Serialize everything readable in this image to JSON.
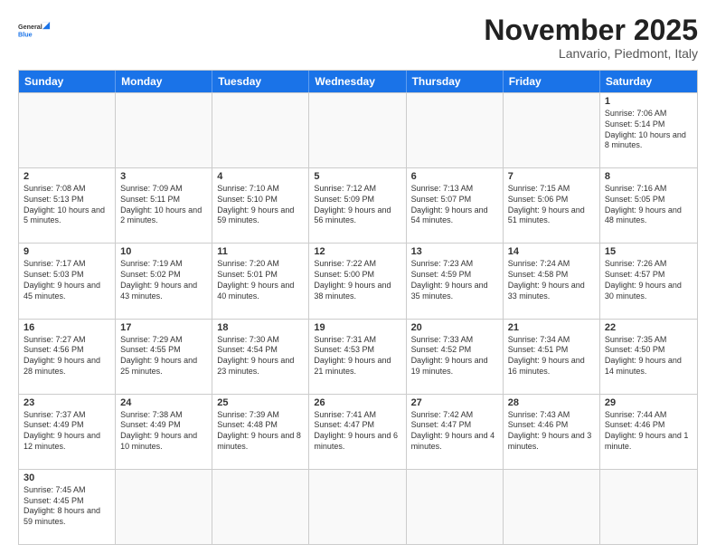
{
  "header": {
    "logo_general": "General",
    "logo_blue": "Blue",
    "month_title": "November 2025",
    "subtitle": "Lanvario, Piedmont, Italy"
  },
  "weekdays": [
    "Sunday",
    "Monday",
    "Tuesday",
    "Wednesday",
    "Thursday",
    "Friday",
    "Saturday"
  ],
  "rows": [
    [
      {
        "day": "",
        "text": ""
      },
      {
        "day": "",
        "text": ""
      },
      {
        "day": "",
        "text": ""
      },
      {
        "day": "",
        "text": ""
      },
      {
        "day": "",
        "text": ""
      },
      {
        "day": "",
        "text": ""
      },
      {
        "day": "1",
        "text": "Sunrise: 7:06 AM\nSunset: 5:14 PM\nDaylight: 10 hours and 8 minutes."
      }
    ],
    [
      {
        "day": "2",
        "text": "Sunrise: 7:08 AM\nSunset: 5:13 PM\nDaylight: 10 hours and 5 minutes."
      },
      {
        "day": "3",
        "text": "Sunrise: 7:09 AM\nSunset: 5:11 PM\nDaylight: 10 hours and 2 minutes."
      },
      {
        "day": "4",
        "text": "Sunrise: 7:10 AM\nSunset: 5:10 PM\nDaylight: 9 hours and 59 minutes."
      },
      {
        "day": "5",
        "text": "Sunrise: 7:12 AM\nSunset: 5:09 PM\nDaylight: 9 hours and 56 minutes."
      },
      {
        "day": "6",
        "text": "Sunrise: 7:13 AM\nSunset: 5:07 PM\nDaylight: 9 hours and 54 minutes."
      },
      {
        "day": "7",
        "text": "Sunrise: 7:15 AM\nSunset: 5:06 PM\nDaylight: 9 hours and 51 minutes."
      },
      {
        "day": "8",
        "text": "Sunrise: 7:16 AM\nSunset: 5:05 PM\nDaylight: 9 hours and 48 minutes."
      }
    ],
    [
      {
        "day": "9",
        "text": "Sunrise: 7:17 AM\nSunset: 5:03 PM\nDaylight: 9 hours and 45 minutes."
      },
      {
        "day": "10",
        "text": "Sunrise: 7:19 AM\nSunset: 5:02 PM\nDaylight: 9 hours and 43 minutes."
      },
      {
        "day": "11",
        "text": "Sunrise: 7:20 AM\nSunset: 5:01 PM\nDaylight: 9 hours and 40 minutes."
      },
      {
        "day": "12",
        "text": "Sunrise: 7:22 AM\nSunset: 5:00 PM\nDaylight: 9 hours and 38 minutes."
      },
      {
        "day": "13",
        "text": "Sunrise: 7:23 AM\nSunset: 4:59 PM\nDaylight: 9 hours and 35 minutes."
      },
      {
        "day": "14",
        "text": "Sunrise: 7:24 AM\nSunset: 4:58 PM\nDaylight: 9 hours and 33 minutes."
      },
      {
        "day": "15",
        "text": "Sunrise: 7:26 AM\nSunset: 4:57 PM\nDaylight: 9 hours and 30 minutes."
      }
    ],
    [
      {
        "day": "16",
        "text": "Sunrise: 7:27 AM\nSunset: 4:56 PM\nDaylight: 9 hours and 28 minutes."
      },
      {
        "day": "17",
        "text": "Sunrise: 7:29 AM\nSunset: 4:55 PM\nDaylight: 9 hours and 25 minutes."
      },
      {
        "day": "18",
        "text": "Sunrise: 7:30 AM\nSunset: 4:54 PM\nDaylight: 9 hours and 23 minutes."
      },
      {
        "day": "19",
        "text": "Sunrise: 7:31 AM\nSunset: 4:53 PM\nDaylight: 9 hours and 21 minutes."
      },
      {
        "day": "20",
        "text": "Sunrise: 7:33 AM\nSunset: 4:52 PM\nDaylight: 9 hours and 19 minutes."
      },
      {
        "day": "21",
        "text": "Sunrise: 7:34 AM\nSunset: 4:51 PM\nDaylight: 9 hours and 16 minutes."
      },
      {
        "day": "22",
        "text": "Sunrise: 7:35 AM\nSunset: 4:50 PM\nDaylight: 9 hours and 14 minutes."
      }
    ],
    [
      {
        "day": "23",
        "text": "Sunrise: 7:37 AM\nSunset: 4:49 PM\nDaylight: 9 hours and 12 minutes."
      },
      {
        "day": "24",
        "text": "Sunrise: 7:38 AM\nSunset: 4:49 PM\nDaylight: 9 hours and 10 minutes."
      },
      {
        "day": "25",
        "text": "Sunrise: 7:39 AM\nSunset: 4:48 PM\nDaylight: 9 hours and 8 minutes."
      },
      {
        "day": "26",
        "text": "Sunrise: 7:41 AM\nSunset: 4:47 PM\nDaylight: 9 hours and 6 minutes."
      },
      {
        "day": "27",
        "text": "Sunrise: 7:42 AM\nSunset: 4:47 PM\nDaylight: 9 hours and 4 minutes."
      },
      {
        "day": "28",
        "text": "Sunrise: 7:43 AM\nSunset: 4:46 PM\nDaylight: 9 hours and 3 minutes."
      },
      {
        "day": "29",
        "text": "Sunrise: 7:44 AM\nSunset: 4:46 PM\nDaylight: 9 hours and 1 minute."
      }
    ],
    [
      {
        "day": "30",
        "text": "Sunrise: 7:45 AM\nSunset: 4:45 PM\nDaylight: 8 hours and 59 minutes."
      },
      {
        "day": "",
        "text": ""
      },
      {
        "day": "",
        "text": ""
      },
      {
        "day": "",
        "text": ""
      },
      {
        "day": "",
        "text": ""
      },
      {
        "day": "",
        "text": ""
      },
      {
        "day": "",
        "text": ""
      }
    ]
  ]
}
